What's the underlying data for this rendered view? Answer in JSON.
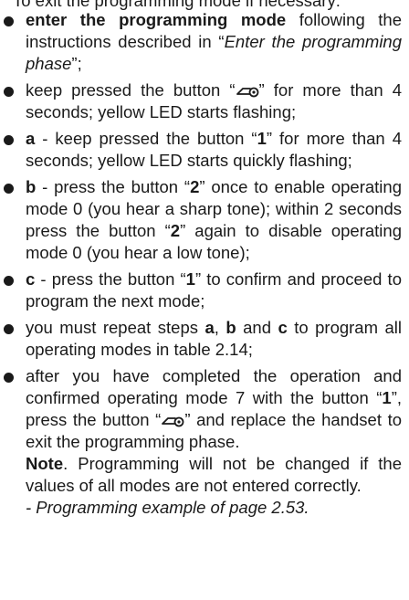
{
  "header_cut": "To exit the programming mode if necessary:",
  "steps": [
    {
      "bold": "enter the programming mode",
      "t1": " following the instructions described in “",
      "italic": "Enter the programming phase",
      "t2": "”;"
    },
    {
      "t1": "keep pressed the button “",
      "t2": "” for more than 4 seconds; yellow LED starts flashing;"
    },
    {
      "bold": "a",
      "t1": " - keep pressed the button “",
      "key": "1",
      "t2": "” for more than 4 seconds; yellow LED starts quickly flashing;"
    },
    {
      "bold": "b",
      "t1": " - press the button “",
      "key1": "2",
      "t2": "” once to enable operating mode 0 (you hear a sharp tone); within 2 seconds press the button “",
      "key2": "2",
      "t3": "” again to disable operating mode 0 (you hear a low tone);"
    },
    {
      "bold": "c",
      "t1": " - press the button “",
      "key": "1",
      "t2": "” to confirm and proceed to program the next mode;"
    },
    {
      "t1": "you must repeat steps ",
      "s1": "a",
      "t2": ", ",
      "s2": "b",
      "t3": " and ",
      "s3": "c",
      "t4": " to program all operating modes in table 2.14;"
    },
    {
      "t1": "after you have completed the operation and confirmed operating mode 7 with the button “",
      "key": "1",
      "t2": "”, press the button “",
      "t3": "” and replace the handset to exit the programming phase.",
      "note_label": "Note",
      "note_text": ". Programming will not be changed if the values of all modes are not entered correctly.",
      "example": "- Programming example of page 2.53."
    }
  ],
  "icons": {
    "key_icon": "key-symbol-icon"
  }
}
